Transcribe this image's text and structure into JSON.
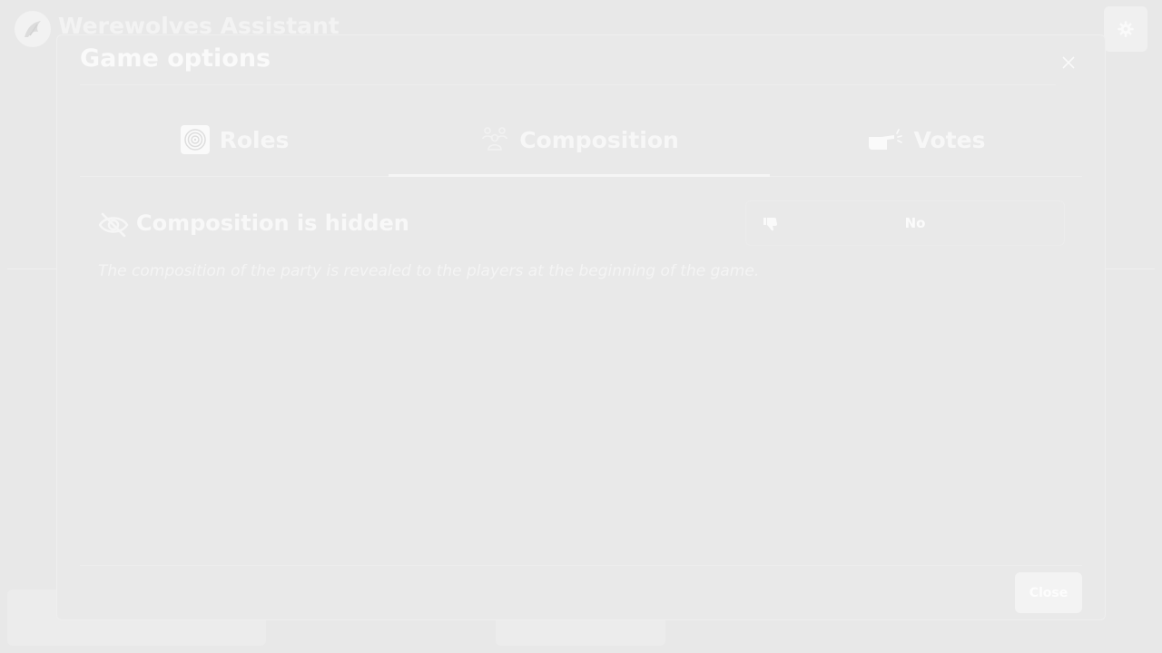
{
  "app": {
    "title": "Werewolves Assistant",
    "logo_icon": "werewolf-logo-icon",
    "settings_icon": "gear-icon"
  },
  "modal": {
    "title": "Game options",
    "close_icon": "close-icon",
    "tabs": [
      {
        "label": "Roles",
        "icon": "spiral-icon",
        "active": false
      },
      {
        "label": "Composition",
        "icon": "people-group-icon",
        "active": true
      },
      {
        "label": "Votes",
        "icon": "pointing-hand-icon",
        "active": false
      }
    ],
    "option": {
      "label": "Composition is hidden",
      "icon": "eye-slash-icon",
      "toggle_icon": "thumbs-down-icon",
      "value": "No",
      "description": "The composition of the party is revealed to the players at the beginning of the game."
    },
    "close_label": "Close"
  },
  "colors": {
    "overlay_background": "#e8e8e8",
    "text": "#f8f8f8"
  }
}
